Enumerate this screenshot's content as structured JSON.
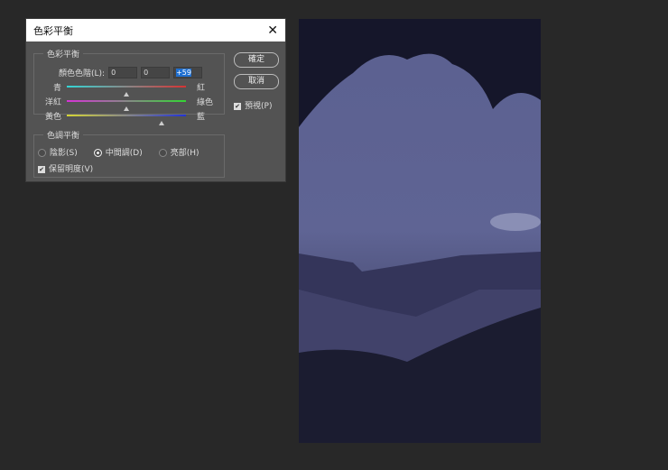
{
  "dialog": {
    "title": "色彩平衡",
    "close": "✕",
    "color_balance": {
      "legend": "色彩平衡",
      "levels_label": "顏色色階(L):",
      "levels": [
        "0",
        "0",
        "+59"
      ],
      "sliders": [
        {
          "left": "青",
          "right": "紅",
          "value": 0,
          "colors": [
            "#33d6d6",
            "#d63333"
          ]
        },
        {
          "left": "洋紅",
          "right": "綠色",
          "value": 0,
          "colors": [
            "#d633d6",
            "#33d633"
          ]
        },
        {
          "left": "黃色",
          "right": "藍",
          "value": 59,
          "colors": [
            "#d6d633",
            "#2233d6"
          ]
        }
      ]
    },
    "tone_balance": {
      "legend": "色調平衡",
      "options": [
        "陰影(S)",
        "中間調(D)",
        "亮部(H)"
      ],
      "selected": 1,
      "preserve": "保留明度(V)",
      "preserve_checked": true
    },
    "ok": "確定",
    "cancel": "取消",
    "preview": "預視(P)",
    "preview_checked": true
  }
}
